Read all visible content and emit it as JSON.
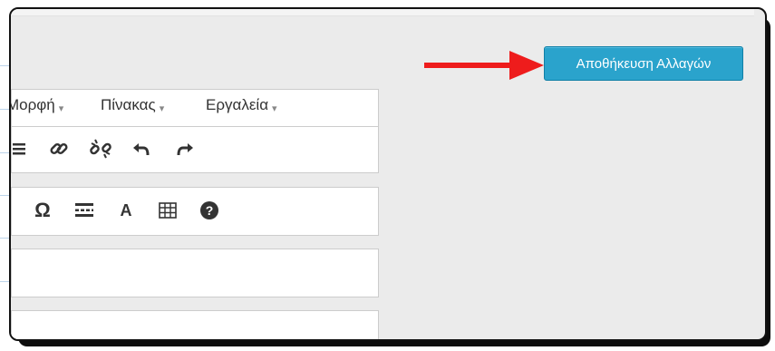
{
  "menu": {
    "items": [
      {
        "label": "Μορφή"
      },
      {
        "label": "Πίνακας"
      },
      {
        "label": "Εργαλεία"
      }
    ],
    "caret": "▾"
  },
  "toolbar1": {
    "icons": [
      "list-icon",
      "link-icon",
      "unlink-icon",
      "undo-icon",
      "redo-icon"
    ]
  },
  "toolbar2": {
    "icons": [
      "special-character-icon",
      "horizontal-rule-icon",
      "text-color-icon",
      "table-icon",
      "help-icon"
    ],
    "omega_symbol": "Ω",
    "text_color_symbol": "A",
    "help_symbol": "?"
  },
  "actions": {
    "save_label": "Αποθήκευση Αλλαγών"
  },
  "colors": {
    "save_button": "#2aa3cc",
    "arrow": "#ee1c1c",
    "editor_background": "#ebebeb"
  }
}
